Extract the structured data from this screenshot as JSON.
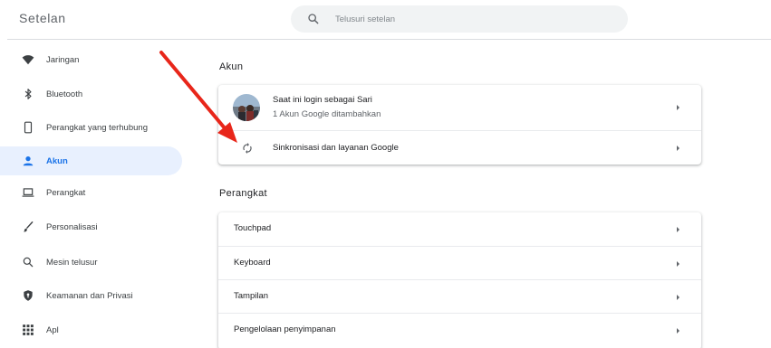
{
  "header": {
    "title": "Setelan",
    "search_placeholder": "Telusuri setelan",
    "search_value": ""
  },
  "sidebar": {
    "items": [
      {
        "label": "Jaringan",
        "icon": "wifi-icon",
        "active": false
      },
      {
        "label": "Bluetooth",
        "icon": "bluetooth-icon",
        "active": false
      },
      {
        "label": "Perangkat yang terhubung",
        "icon": "phone-icon",
        "active": false
      },
      {
        "label": "Akun",
        "icon": "person-icon",
        "active": true
      },
      {
        "label": "Perangkat",
        "icon": "laptop-icon",
        "active": false
      },
      {
        "label": "Personalisasi",
        "icon": "brush-icon",
        "active": false
      },
      {
        "label": "Mesin telusur",
        "icon": "search-icon",
        "active": false
      },
      {
        "label": "Keamanan dan Privasi",
        "icon": "shield-icon",
        "active": false
      },
      {
        "label": "Apl",
        "icon": "apps-grid-icon",
        "active": false
      }
    ]
  },
  "main": {
    "akun": {
      "title": "Akun",
      "profile_name": "Saat ini login sebagai Sari",
      "profile_sub": "1 Akun Google ditambahkan",
      "sync_label": "Sinkronisasi dan layanan Google"
    },
    "perangkat": {
      "title": "Perangkat",
      "rows": [
        {
          "label": "Touchpad"
        },
        {
          "label": "Keyboard"
        },
        {
          "label": "Tampilan"
        },
        {
          "label": "Pengelolaan penyimpanan"
        }
      ]
    }
  },
  "colors": {
    "accent": "#1a73e8",
    "active_bg": "#e8f0fe",
    "annotation_arrow": "#e8261a"
  }
}
